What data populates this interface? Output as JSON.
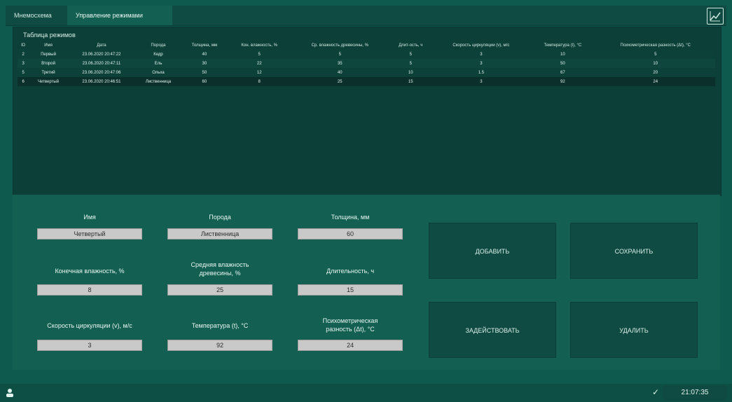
{
  "tabs": [
    {
      "label": "Мнемосхема"
    },
    {
      "label": "Управление режимами"
    }
  ],
  "table": {
    "title": "Таблица режимов",
    "columns": [
      "ID",
      "Имя",
      "Дата",
      "Порода",
      "Толщина, мм",
      "Кон. влажность, %",
      "Ср. влажность древесины, %",
      "Длит-ость, ч",
      "Скорость циркуляции (v), м/с",
      "Температура (t), °С",
      "Психометрическая разность (Δt), °С"
    ],
    "rows": [
      [
        "2",
        "Первый",
        "23.06.2020 20:47:22",
        "Кедр",
        "40",
        "5",
        "5",
        "5",
        "3",
        "10",
        "5"
      ],
      [
        "3",
        "Второй",
        "23.06.2020 20:47:11",
        "Ель",
        "30",
        "22",
        "35",
        "5",
        "3",
        "50",
        "10"
      ],
      [
        "5",
        "Третий",
        "23.06.2020 20:47:06",
        "Ольха",
        "50",
        "12",
        "40",
        "10",
        "1.5",
        "67",
        "20"
      ],
      [
        "6",
        "Четвертый",
        "23.06.2020 20:46:51",
        "Лиственница",
        "60",
        "8",
        "25",
        "15",
        "3",
        "92",
        "24"
      ]
    ]
  },
  "form": {
    "name_label": "Имя",
    "name_value": "Четвертый",
    "breed_label": "Порода",
    "breed_value": "Лиственница",
    "thickness_label": "Толщина, мм",
    "thickness_value": "60",
    "final_moisture_label": "Конечная влажность, %",
    "final_moisture_value": "8",
    "avg_moisture_label_line1": "Средняя влажность",
    "avg_moisture_label_line2": "древесины, %",
    "avg_moisture_value": "25",
    "duration_label": "Длительность, ч",
    "duration_value": "15",
    "circulation_label": "Скорость циркуляции (v), м/с",
    "circulation_value": "3",
    "temperature_label": "Температура (t), °С",
    "temperature_value": "92",
    "psy_label_line1": "Психометрическая",
    "psy_label_line2": "разность (Δt), °С",
    "psy_value": "24"
  },
  "buttons": {
    "add": "ДОБАВИТЬ",
    "save": "СОХРАНИТЬ",
    "apply": "ЗАДЕЙСТВОВАТЬ",
    "delete": "УДАЛИТЬ"
  },
  "status": {
    "time": "21:07:35"
  },
  "icons": {
    "brand": "chart-icon",
    "user": "user-icon",
    "check": "check-icon"
  },
  "colors": {
    "background": "#0e5a4e",
    "panel": "#0c3f37",
    "button": "#0f4b42",
    "field": "#c9c9c9"
  }
}
